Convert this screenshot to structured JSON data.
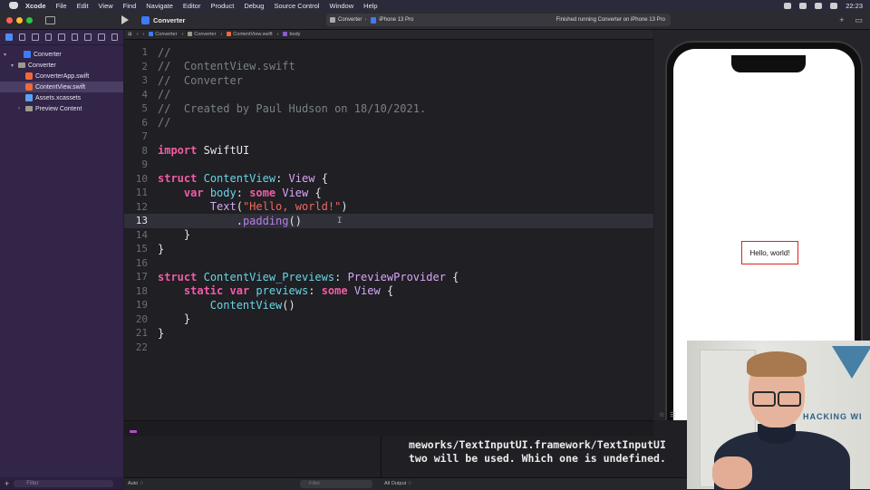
{
  "menubar": {
    "app": "Xcode",
    "items": [
      "File",
      "Edit",
      "View",
      "Find",
      "Navigate",
      "Editor",
      "Product",
      "Debug",
      "Source Control",
      "Window",
      "Help"
    ],
    "clock": "22:23"
  },
  "toolbar": {
    "project": "Converter",
    "scheme": "Converter",
    "device": "iPhone 13 Pro",
    "status": "Finished running Converter on iPhone 13 Pro"
  },
  "navigator": {
    "items": [
      {
        "label": "Converter",
        "icon": "project-icon",
        "indent": 0
      },
      {
        "label": "Converter",
        "icon": "folder-icon",
        "indent": 1
      },
      {
        "label": "ConverterApp.swift",
        "icon": "swift-file-icon",
        "indent": 2
      },
      {
        "label": "ContentView.swift",
        "icon": "swift-file-icon",
        "indent": 2,
        "selected": true
      },
      {
        "label": "Assets.xcassets",
        "icon": "assets-icon",
        "indent": 2
      },
      {
        "label": "Preview Content",
        "icon": "folder-icon",
        "indent": 2
      }
    ],
    "filter_placeholder": "Filter"
  },
  "jumpbar": {
    "crumbs": [
      "Converter",
      "Converter",
      "ContentView.swift",
      "body"
    ]
  },
  "editor": {
    "current_line": 13,
    "lines": [
      {
        "n": "1",
        "t": "//"
      },
      {
        "n": "2",
        "t": "//  ContentView.swift"
      },
      {
        "n": "3",
        "t": "//  Converter"
      },
      {
        "n": "4",
        "t": "//"
      },
      {
        "n": "5",
        "t": "//  Created by Paul Hudson on 18/10/2021."
      },
      {
        "n": "6",
        "t": "//"
      },
      {
        "n": "7",
        "t": ""
      },
      {
        "n": "8",
        "t": "import SwiftUI"
      },
      {
        "n": "9",
        "t": ""
      },
      {
        "n": "10",
        "t": "struct ContentView: View {"
      },
      {
        "n": "11",
        "t": "    var body: some View {"
      },
      {
        "n": "12",
        "t": "        Text(\"Hello, world!\")"
      },
      {
        "n": "13",
        "t": "            .padding()"
      },
      {
        "n": "14",
        "t": "    }"
      },
      {
        "n": "15",
        "t": "}"
      },
      {
        "n": "16",
        "t": ""
      },
      {
        "n": "17",
        "t": "struct ContentView_Previews: PreviewProvider {"
      },
      {
        "n": "18",
        "t": "    static var previews: some View {"
      },
      {
        "n": "19",
        "t": "        ContentView()"
      },
      {
        "n": "20",
        "t": "    }"
      },
      {
        "n": "21",
        "t": "}"
      },
      {
        "n": "22",
        "t": ""
      }
    ]
  },
  "console": {
    "lines": [
      "meworks/TextInputUI.framework/TextInputUI",
      "two will be used. Which one is undefined."
    ]
  },
  "bottombar": {
    "auto": "Auto ♢",
    "filter_placeholder": "Filter",
    "output": "All Output ♢"
  },
  "preview": {
    "label": "Hello, world!"
  },
  "webcam": {
    "sign_text": "HACKING WI"
  }
}
